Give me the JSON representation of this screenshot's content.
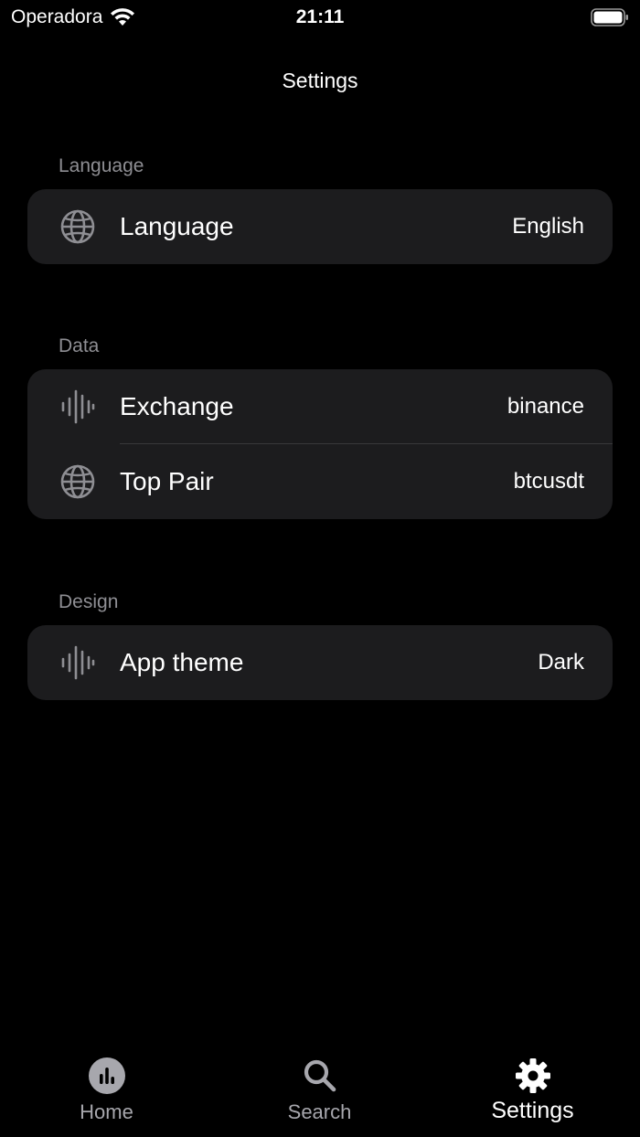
{
  "status_bar": {
    "carrier": "Operadora",
    "time": "21:11"
  },
  "nav": {
    "title": "Settings"
  },
  "sections": [
    {
      "header": "Language",
      "rows": [
        {
          "icon": "globe-icon",
          "label": "Language",
          "value": "English"
        }
      ]
    },
    {
      "header": "Data",
      "rows": [
        {
          "icon": "waveform-icon",
          "label": "Exchange",
          "value": "binance"
        },
        {
          "icon": "globe-icon",
          "label": "Top Pair",
          "value": "btcusdt"
        }
      ]
    },
    {
      "header": "Design",
      "rows": [
        {
          "icon": "waveform-icon",
          "label": "App theme",
          "value": "Dark"
        }
      ]
    }
  ],
  "tab_bar": {
    "tabs": [
      {
        "icon": "chart-icon",
        "label": "Home",
        "active": false
      },
      {
        "icon": "search-icon",
        "label": "Search",
        "active": false
      },
      {
        "icon": "gear-icon",
        "label": "Settings",
        "active": true
      }
    ]
  },
  "colors": {
    "background": "#000000",
    "cell": "#1c1c1e",
    "secondary_text": "#8e8e93",
    "icon_gray": "#8e8e93"
  }
}
